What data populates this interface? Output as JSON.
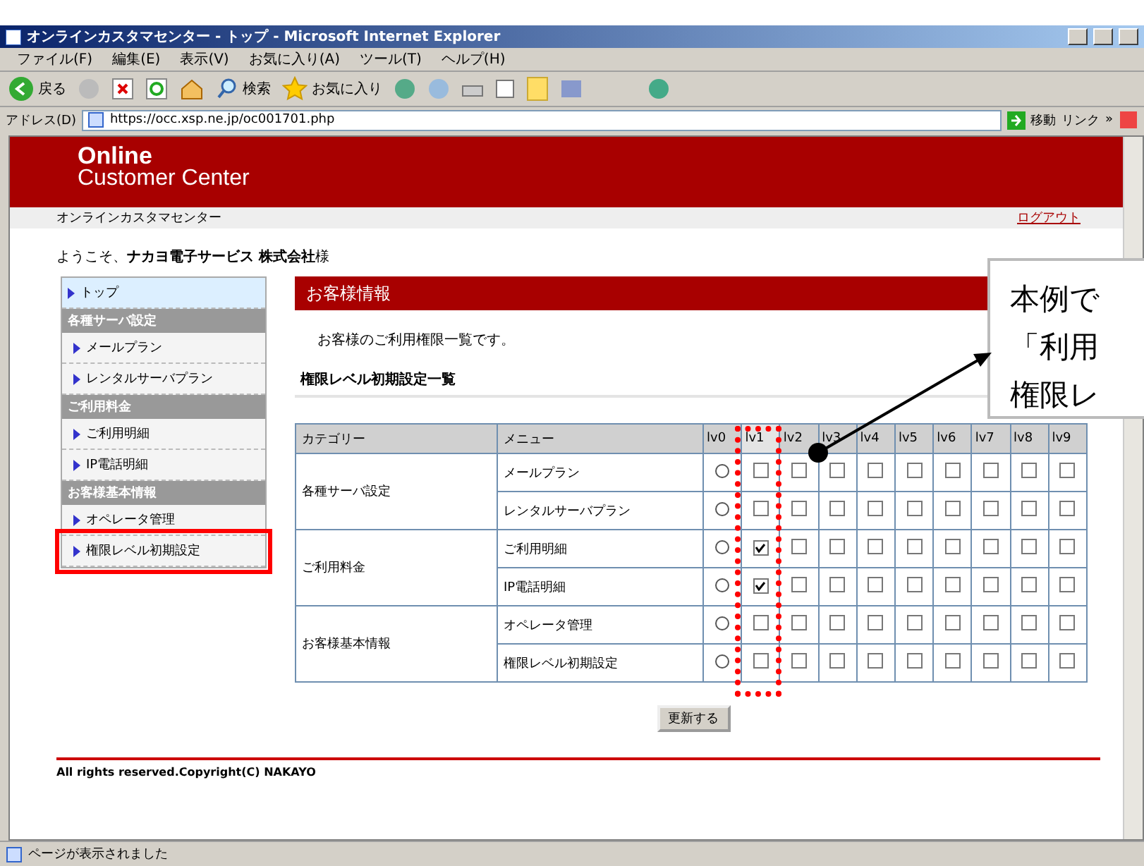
{
  "window": {
    "title": "オンラインカスタマセンター - トップ - Microsoft Internet Explorer"
  },
  "menu_bar": [
    "ファイル(F)",
    "編集(E)",
    "表示(V)",
    "お気に入り(A)",
    "ツール(T)",
    "ヘルプ(H)"
  ],
  "toolbar": {
    "back": "戻る",
    "search": "検索",
    "favorites": "お気に入り"
  },
  "address_bar": {
    "label": "アドレス(D)",
    "value": "https://occ.xsp.ne.jp/oc001701.php",
    "go": "移動",
    "links": "リンク",
    "more": "»"
  },
  "header": {
    "logo_line_1": "Online",
    "logo_line_2": "Customer Center",
    "subtitle": "オンラインカスタマセンター",
    "logout": "ログアウト"
  },
  "welcome": {
    "prefix": "ようこそ、",
    "company": "ナカヨ電子サービス 株式会社",
    "suffix": "様"
  },
  "sidebar": {
    "items": [
      {
        "kind": "link",
        "label": "トップ",
        "selected": true,
        "highlighted": false
      },
      {
        "kind": "group",
        "label": "各種サーバ設定"
      },
      {
        "kind": "link",
        "label": "メールプラン",
        "selected": false,
        "highlighted": false
      },
      {
        "kind": "link",
        "label": "レンタルサーバプラン",
        "selected": false,
        "highlighted": false
      },
      {
        "kind": "group",
        "label": "ご利用料金"
      },
      {
        "kind": "link",
        "label": "ご利用明細",
        "selected": false,
        "highlighted": false
      },
      {
        "kind": "link",
        "label": "IP電話明細",
        "selected": false,
        "highlighted": false
      },
      {
        "kind": "group",
        "label": "お客様基本情報"
      },
      {
        "kind": "link",
        "label": "オペレータ管理",
        "selected": false,
        "highlighted": false
      },
      {
        "kind": "link",
        "label": "権限レベル初期設定",
        "selected": false,
        "highlighted": true
      }
    ]
  },
  "main": {
    "title": "お客様情報",
    "description": "お客様のご利用権限一覧です。",
    "section_heading": "権限レベル初期設定一覧"
  },
  "table": {
    "columns": [
      {
        "label": "カテゴリー",
        "highlighted": false
      },
      {
        "label": "メニュー",
        "highlighted": false
      },
      {
        "label": "lv0",
        "highlighted": false
      },
      {
        "label": "lv1",
        "highlighted": true
      },
      {
        "label": "lv2",
        "highlighted": false
      },
      {
        "label": "lv3",
        "highlighted": false
      },
      {
        "label": "lv4",
        "highlighted": false
      },
      {
        "label": "lv5",
        "highlighted": false
      },
      {
        "label": "lv6",
        "highlighted": false
      },
      {
        "label": "lv7",
        "highlighted": false
      },
      {
        "label": "lv8",
        "highlighted": false
      },
      {
        "label": "lv9",
        "highlighted": false
      }
    ],
    "groups": [
      {
        "category": "各種サーバ設定",
        "rows": [
          {
            "menu": "メールプラン",
            "radio_selected": false,
            "checks": [
              false,
              false,
              false,
              false,
              false,
              false,
              false,
              false,
              false
            ]
          },
          {
            "menu": "レンタルサーバプラン",
            "radio_selected": false,
            "checks": [
              false,
              false,
              false,
              false,
              false,
              false,
              false,
              false,
              false
            ]
          }
        ]
      },
      {
        "category": "ご利用料金",
        "rows": [
          {
            "menu": "ご利用明細",
            "radio_selected": false,
            "checks": [
              true,
              false,
              false,
              false,
              false,
              false,
              false,
              false,
              false
            ]
          },
          {
            "menu": "IP電話明細",
            "radio_selected": false,
            "checks": [
              true,
              false,
              false,
              false,
              false,
              false,
              false,
              false,
              false
            ]
          }
        ]
      },
      {
        "category": "お客様基本情報",
        "rows": [
          {
            "menu": "オペレータ管理",
            "radio_selected": false,
            "checks": [
              false,
              false,
              false,
              false,
              false,
              false,
              false,
              false,
              false
            ]
          },
          {
            "menu": "権限レベル初期設定",
            "radio_selected": false,
            "checks": [
              false,
              false,
              false,
              false,
              false,
              false,
              false,
              false,
              false
            ]
          }
        ]
      }
    ]
  },
  "update_button": "更新する",
  "footer": {
    "copyright": "All rights reserved.Copyright(C) NAKAYO"
  },
  "callout": {
    "lines": [
      "本例で",
      "「利用",
      "権限レ"
    ]
  },
  "status_bar": {
    "text": "ページが表示されました"
  }
}
